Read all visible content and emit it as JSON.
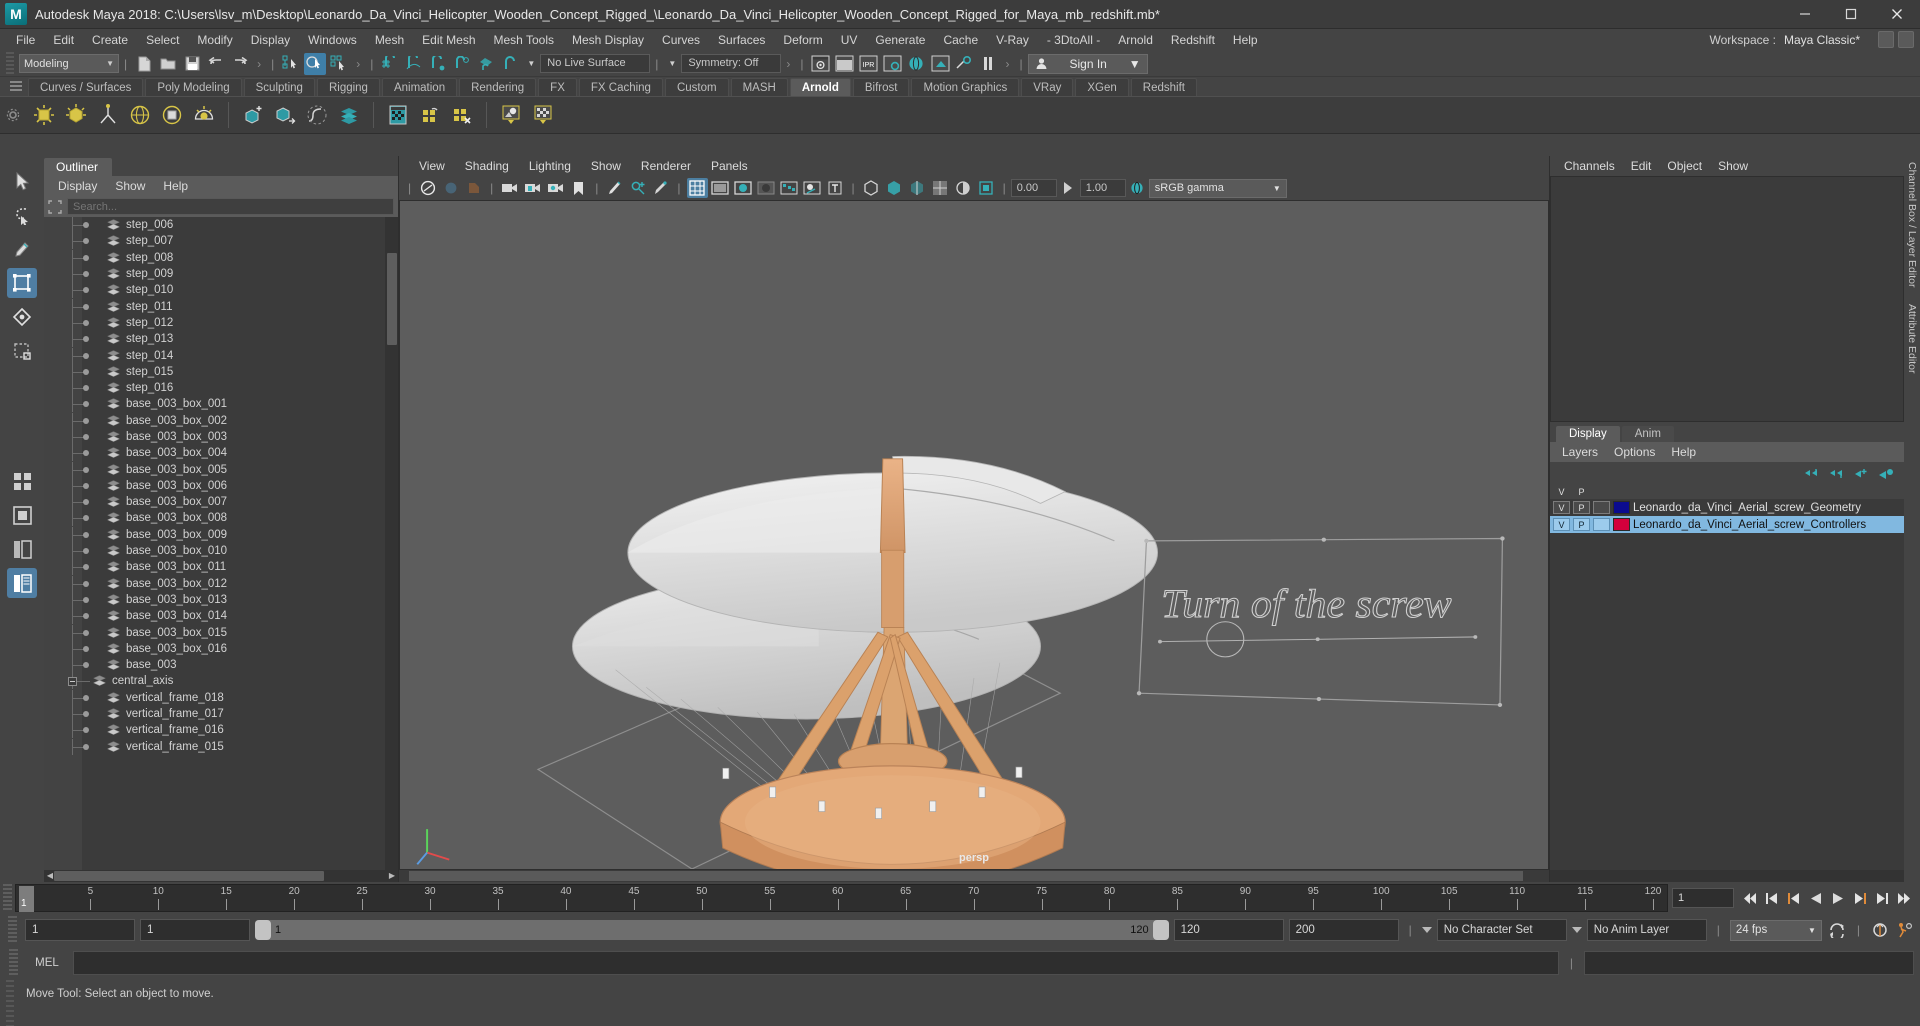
{
  "window": {
    "title": "Autodesk Maya 2018: C:\\Users\\lsv_m\\Desktop\\Leonardo_Da_Vinci_Helicopter_Wooden_Concept_Rigged_\\Leonardo_Da_Vinci_Helicopter_Wooden_Concept_Rigged_for_Maya_mb_redshift.mb*",
    "logo": "M",
    "minimize": "—",
    "maximize": "□",
    "close": "✕"
  },
  "menubar": {
    "items": [
      "File",
      "Edit",
      "Create",
      "Select",
      "Modify",
      "Display",
      "Windows",
      "Mesh",
      "Edit Mesh",
      "Mesh Tools",
      "Mesh Display",
      "Curves",
      "Surfaces",
      "Deform",
      "UV",
      "Generate",
      "Cache",
      "V-Ray",
      "- 3DtoAll -",
      "Arnold",
      "Redshift",
      "Help"
    ],
    "workspace_label": "Workspace :",
    "workspace_value": "Maya Classic*"
  },
  "statusline": {
    "menuset": "Modeling",
    "live_surface": "No Live Surface",
    "symmetry": "Symmetry: Off",
    "signin": "Sign In",
    "ipr_label": "IPR"
  },
  "shelf": {
    "tabs": [
      "Curves / Surfaces",
      "Poly Modeling",
      "Sculpting",
      "Rigging",
      "Animation",
      "Rendering",
      "FX",
      "FX Caching",
      "Custom",
      "MASH",
      "Arnold",
      "Bifrost",
      "Motion Graphics",
      "VRay",
      "XGen",
      "Redshift"
    ],
    "active_tab": "Arnold"
  },
  "outliner": {
    "tab": "Outliner",
    "menus": [
      "Display",
      "Show",
      "Help"
    ],
    "search_placeholder": "Search...",
    "items": [
      {
        "label": "step_006",
        "level": 2
      },
      {
        "label": "step_007",
        "level": 2
      },
      {
        "label": "step_008",
        "level": 2
      },
      {
        "label": "step_009",
        "level": 2
      },
      {
        "label": "step_010",
        "level": 2
      },
      {
        "label": "step_011",
        "level": 2
      },
      {
        "label": "step_012",
        "level": 2
      },
      {
        "label": "step_013",
        "level": 2
      },
      {
        "label": "step_014",
        "level": 2
      },
      {
        "label": "step_015",
        "level": 2
      },
      {
        "label": "step_016",
        "level": 2
      },
      {
        "label": "base_003_box_001",
        "level": 2
      },
      {
        "label": "base_003_box_002",
        "level": 2
      },
      {
        "label": "base_003_box_003",
        "level": 2
      },
      {
        "label": "base_003_box_004",
        "level": 2
      },
      {
        "label": "base_003_box_005",
        "level": 2
      },
      {
        "label": "base_003_box_006",
        "level": 2
      },
      {
        "label": "base_003_box_007",
        "level": 2
      },
      {
        "label": "base_003_box_008",
        "level": 2
      },
      {
        "label": "base_003_box_009",
        "level": 2
      },
      {
        "label": "base_003_box_010",
        "level": 2
      },
      {
        "label": "base_003_box_011",
        "level": 2
      },
      {
        "label": "base_003_box_012",
        "level": 2
      },
      {
        "label": "base_003_box_013",
        "level": 2
      },
      {
        "label": "base_003_box_014",
        "level": 2
      },
      {
        "label": "base_003_box_015",
        "level": 2
      },
      {
        "label": "base_003_box_016",
        "level": 2
      },
      {
        "label": "base_003",
        "level": 2
      },
      {
        "label": "central_axis",
        "level": 1,
        "expandable": true
      },
      {
        "label": "vertical_frame_018",
        "level": 2
      },
      {
        "label": "vertical_frame_017",
        "level": 2
      },
      {
        "label": "vertical_frame_016",
        "level": 2
      },
      {
        "label": "vertical_frame_015",
        "level": 2
      }
    ]
  },
  "viewport": {
    "menus": [
      "View",
      "Shading",
      "Lighting",
      "Show",
      "Renderer",
      "Panels"
    ],
    "exposure": "0.00",
    "gain": "1.00",
    "color_management": "sRGB gamma",
    "camera_label": "persp",
    "annotation_text": "Turn of the screw"
  },
  "channelbox": {
    "menus": [
      "Channels",
      "Edit",
      "Object",
      "Show"
    ],
    "side_labels": [
      "Channel Box / Layer Editor",
      "Attribute Editor"
    ]
  },
  "layers": {
    "tabs": [
      "Display",
      "Anim"
    ],
    "active_tab": "Display",
    "menus": [
      "Layers",
      "Options",
      "Help"
    ],
    "col_v": "V",
    "col_p": "P",
    "rows": [
      {
        "v": "V",
        "p": "P",
        "t": "",
        "color": "#0b0b8f",
        "name": "Leonardo_da_Vinci_Aerial_screw_Geometry",
        "selected": false
      },
      {
        "v": "V",
        "p": "P",
        "t": "",
        "color": "#d4003c",
        "name": "Leonardo_da_Vinci_Aerial_screw_Controllers",
        "selected": true
      }
    ]
  },
  "timeline": {
    "ticks": [
      5,
      10,
      15,
      20,
      25,
      30,
      35,
      40,
      45,
      50,
      55,
      60,
      65,
      70,
      75,
      80,
      85,
      90,
      95,
      100,
      105,
      110,
      115,
      120
    ],
    "start": 1,
    "end": 120,
    "current_frame": "1",
    "current_marker": "1"
  },
  "range": {
    "anim_start": "1",
    "range_start": "1",
    "slider_start": "1",
    "slider_end": "120",
    "range_end": "120",
    "anim_end": "200",
    "character_set": "No Character Set",
    "anim_layer": "No Anim Layer",
    "fps": "24 fps"
  },
  "command": {
    "label": "MEL"
  },
  "status": {
    "message": "Move Tool: Select an object to move."
  },
  "colors": {
    "accent_teal": "#35b0b8",
    "accent_yellow": "#d8c547",
    "select_blue": "#4f7ea3",
    "layer_select": "#81b8e0",
    "wood": "#e0a878",
    "rotor": "#e2e2e2"
  }
}
